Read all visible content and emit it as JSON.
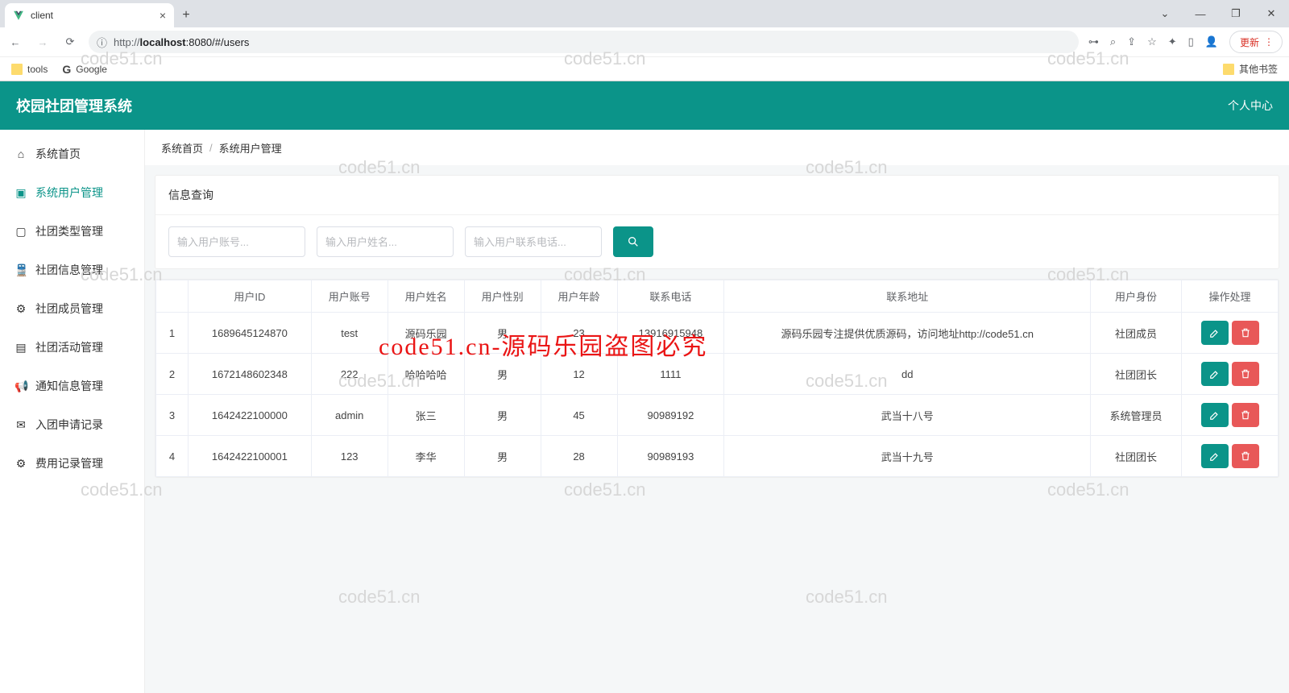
{
  "browser": {
    "tab_title": "client",
    "url_proto": "http://",
    "url_host": "localhost",
    "url_port_path": ":8080/#/users",
    "update_label": "更新",
    "bookmarks": {
      "tools": "tools",
      "google": "Google",
      "other": "其他书签"
    }
  },
  "header": {
    "title": "校园社团管理系统",
    "right": "个人中心"
  },
  "sidebar": {
    "items": [
      {
        "icon": "home-icon",
        "label": "系统首页"
      },
      {
        "icon": "user-icon",
        "label": "系统用户管理"
      },
      {
        "icon": "book-icon",
        "label": "社团类型管理"
      },
      {
        "icon": "train-icon",
        "label": "社团信息管理"
      },
      {
        "icon": "cluster-icon",
        "label": "社团成员管理"
      },
      {
        "icon": "calendar-icon",
        "label": "社团活动管理"
      },
      {
        "icon": "megaphone-icon",
        "label": "通知信息管理"
      },
      {
        "icon": "mail-icon",
        "label": "入团申请记录"
      },
      {
        "icon": "gear-icon",
        "label": "费用记录管理"
      }
    ],
    "active_index": 1
  },
  "breadcrumb": {
    "root": "系统首页",
    "current": "系统用户管理"
  },
  "search": {
    "panel_title": "信息查询",
    "ph_account": "输入用户账号...",
    "ph_name": "输入用户姓名...",
    "ph_phone": "输入用户联系电话..."
  },
  "table": {
    "headers": [
      "",
      "用户ID",
      "用户账号",
      "用户姓名",
      "用户性别",
      "用户年龄",
      "联系电话",
      "联系地址",
      "用户身份",
      "操作处理"
    ],
    "rows": [
      {
        "idx": "1",
        "id": "1689645124870",
        "account": "test",
        "name": "源码乐园",
        "gender": "男",
        "age": "23",
        "phone": "13916915948",
        "addr": "源码乐园专注提供优质源码，访问地址http://code51.cn",
        "role": "社团成员"
      },
      {
        "idx": "2",
        "id": "1672148602348",
        "account": "222",
        "name": "哈哈哈哈",
        "gender": "男",
        "age": "12",
        "phone": "1111",
        "addr": "dd",
        "role": "社团团长"
      },
      {
        "idx": "3",
        "id": "1642422100000",
        "account": "admin",
        "name": "张三",
        "gender": "男",
        "age": "45",
        "phone": "90989192",
        "addr": "武当十八号",
        "role": "系统管理员"
      },
      {
        "idx": "4",
        "id": "1642422100001",
        "account": "123",
        "name": "李华",
        "gender": "男",
        "age": "28",
        "phone": "90989193",
        "addr": "武当十九号",
        "role": "社团团长"
      }
    ]
  },
  "watermarks": {
    "text": "code51.cn",
    "red": "code51.cn-源码乐园盗图必究"
  }
}
